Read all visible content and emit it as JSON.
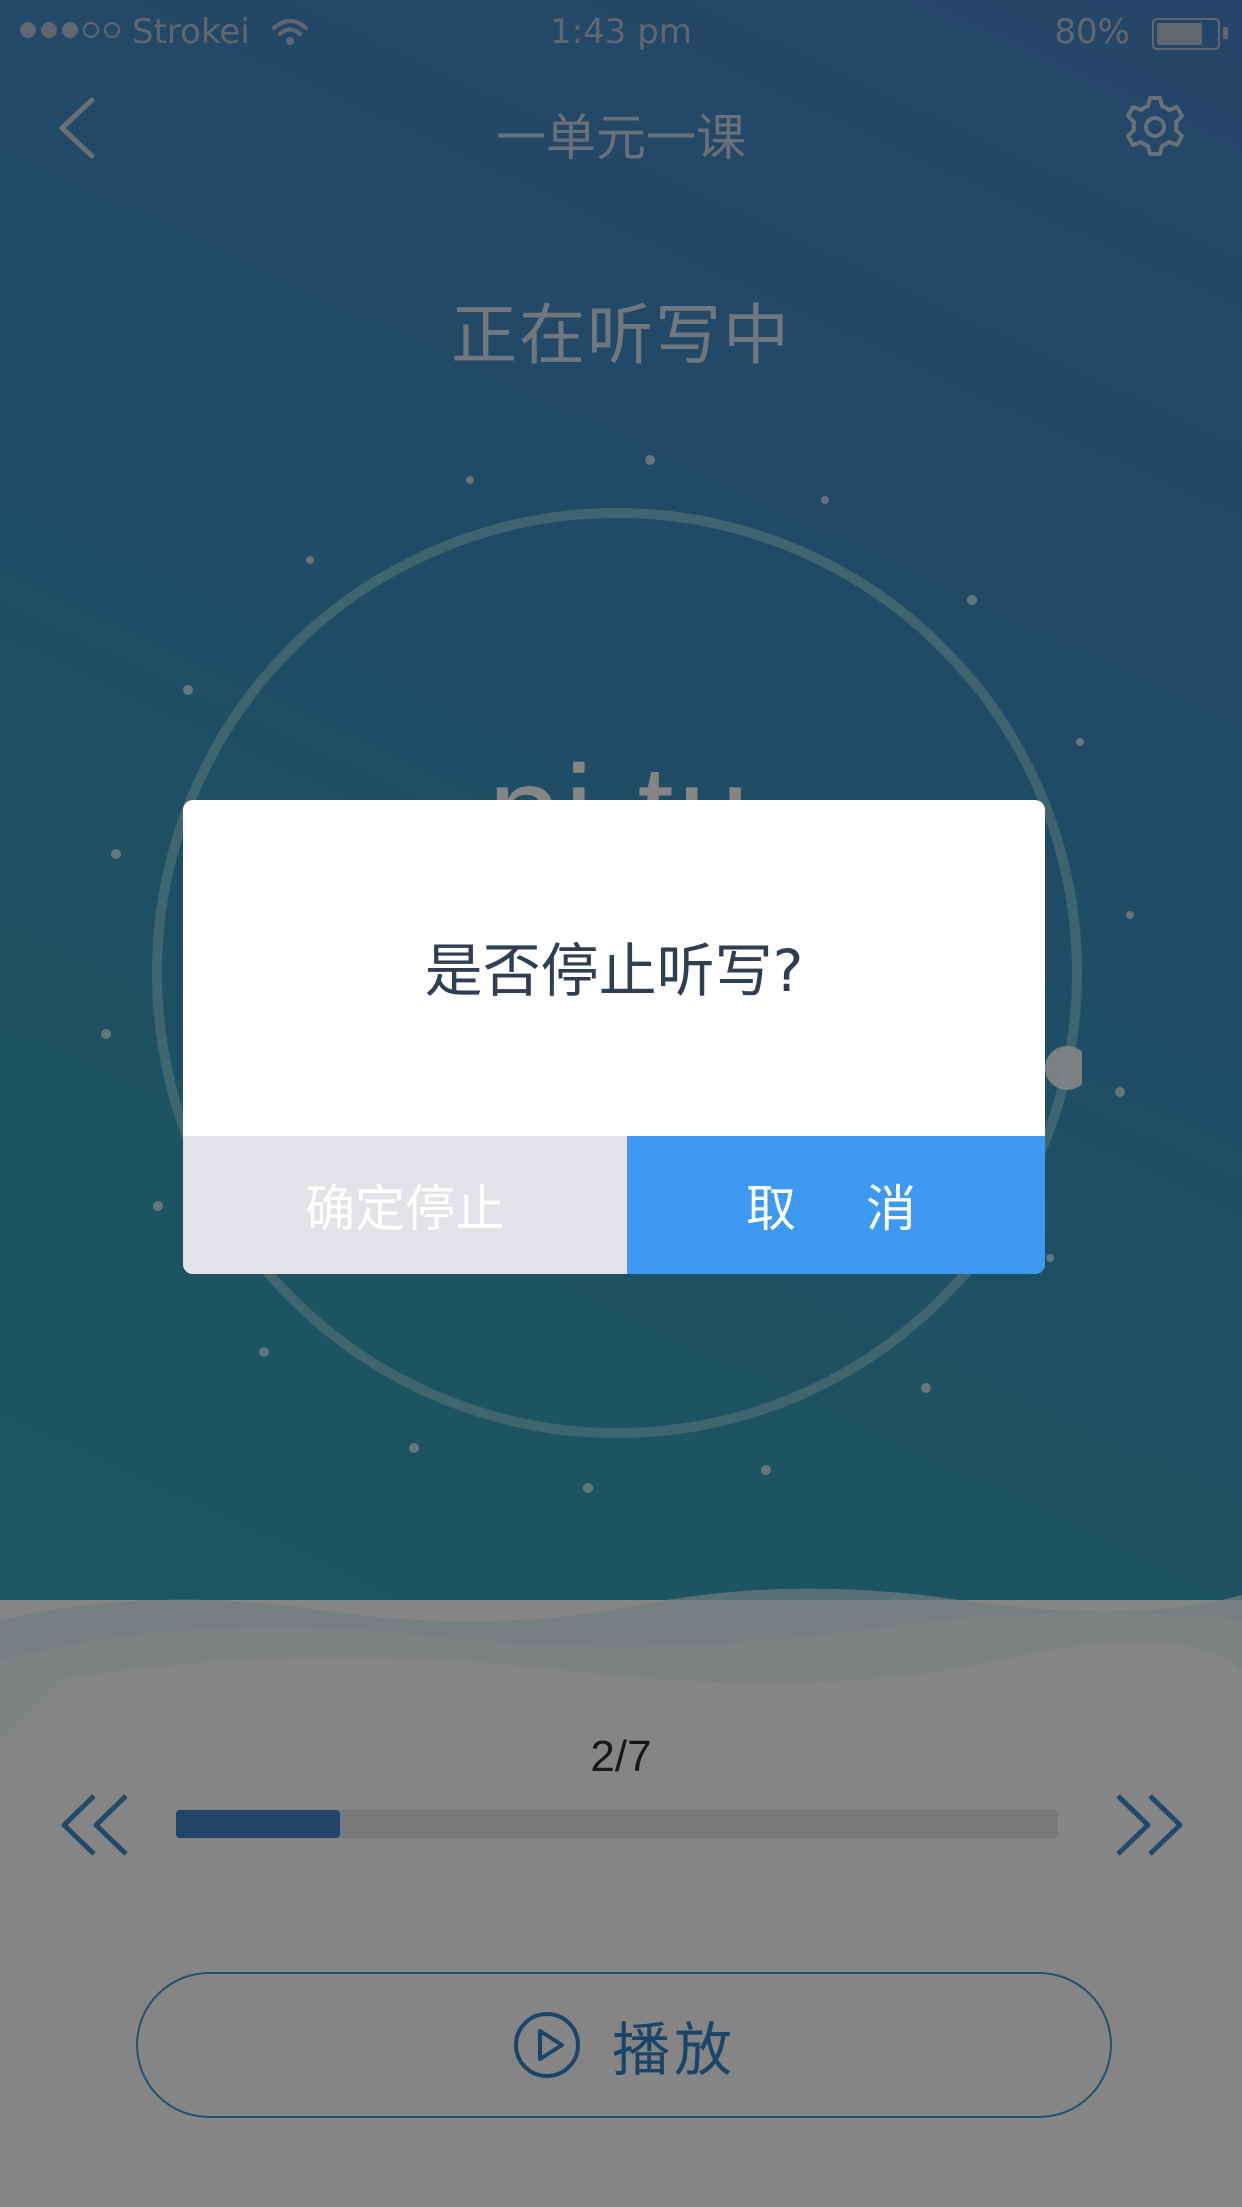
{
  "status_bar": {
    "carrier": "Strokei",
    "time": "1:43 pm",
    "battery_percent": "80%",
    "battery_level": 0.8,
    "signal_bars_filled": 3,
    "signal_bars_total": 5
  },
  "nav": {
    "title": "一单元一课",
    "back_icon": "chevron-left-icon",
    "settings_icon": "gear-icon"
  },
  "dictation": {
    "heading": "正在听写中",
    "pinyin": "pi tu",
    "timer_progress": 0.97
  },
  "progress": {
    "counter": "2/7",
    "current": 2,
    "total": 7,
    "fraction": 0.186
  },
  "controls": {
    "prev_icon": "double-chevron-left-icon",
    "next_icon": "double-chevron-right-icon",
    "play_icon": "play-circle-icon",
    "play_label": "播放"
  },
  "dialog": {
    "message": "是否停止听写?",
    "confirm_label": "确定停止",
    "cancel_label": "取　消"
  },
  "colors": {
    "accent_blue": "#3e99f2",
    "progress_blue": "#3e86c9",
    "confirm_gray": "#e3e3e7",
    "background_teal": "#3aa9b4"
  }
}
